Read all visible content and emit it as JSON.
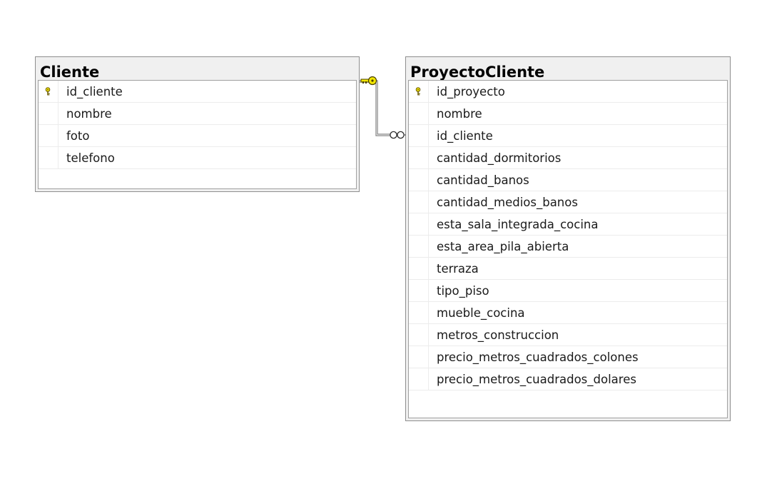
{
  "diagram": {
    "tables": [
      {
        "title": "Cliente",
        "columns": [
          {
            "name": "id_cliente",
            "primary_key": true
          },
          {
            "name": "nombre",
            "primary_key": false
          },
          {
            "name": "foto",
            "primary_key": false
          },
          {
            "name": "telefono",
            "primary_key": false
          }
        ]
      },
      {
        "title": "ProyectoCliente",
        "columns": [
          {
            "name": "id_proyecto",
            "primary_key": true
          },
          {
            "name": "nombre",
            "primary_key": false
          },
          {
            "name": "id_cliente",
            "primary_key": false
          },
          {
            "name": "cantidad_dormitorios",
            "primary_key": false
          },
          {
            "name": "cantidad_banos",
            "primary_key": false
          },
          {
            "name": "cantidad_medios_banos",
            "primary_key": false
          },
          {
            "name": "esta_sala_integrada_cocina",
            "primary_key": false
          },
          {
            "name": "esta_area_pila_abierta",
            "primary_key": false
          },
          {
            "name": "terraza",
            "primary_key": false
          },
          {
            "name": "tipo_piso",
            "primary_key": false
          },
          {
            "name": "mueble_cocina",
            "primary_key": false
          },
          {
            "name": "metros_construccion",
            "primary_key": false
          },
          {
            "name": "precio_metros_cuadrados_colones",
            "primary_key": false
          },
          {
            "name": "precio_metros_cuadrados_dolares",
            "primary_key": false
          }
        ]
      }
    ],
    "relationship": {
      "from_table": "Cliente",
      "to_table": "ProyectoCliente",
      "one_end_icon": "key-icon",
      "many_end_icon": "infinity-icon",
      "key_color": "#f2e600"
    }
  }
}
